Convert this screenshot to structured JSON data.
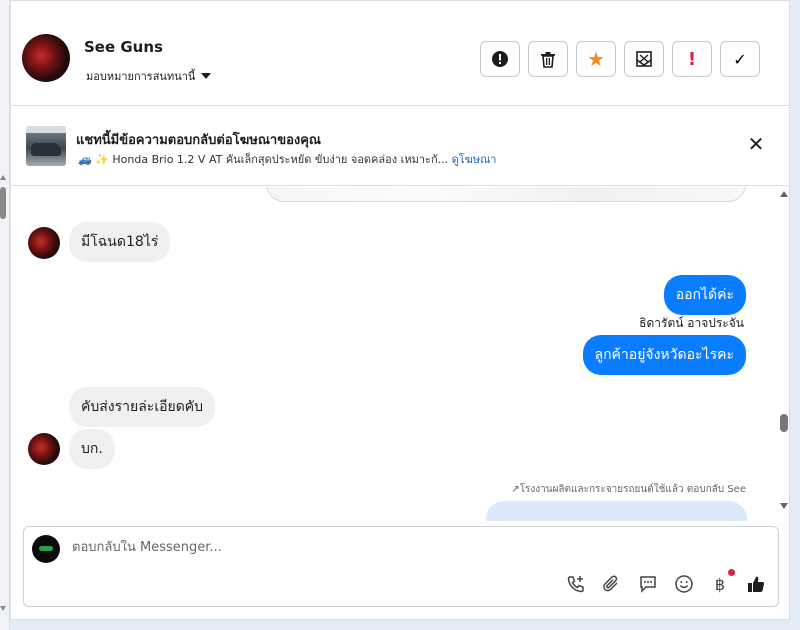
{
  "contact": {
    "name": "See Guns",
    "assign_label": "มอบหมายการสนทนานี้"
  },
  "actions": [
    {
      "name": "report-button",
      "glyph": "!"
    },
    {
      "name": "delete-button",
      "glyph": "🗑"
    },
    {
      "name": "star-button",
      "glyph": "★"
    },
    {
      "name": "mark-unread-button",
      "glyph": "✉"
    },
    {
      "name": "spam-button",
      "glyph": "!"
    },
    {
      "name": "done-button",
      "glyph": "✓"
    }
  ],
  "ad_banner": {
    "title": "แชทนี้มีข้อความตอบกลับต่อโฆษณาของคุณ",
    "subtitle": "🚙 ✨ Honda Brio 1.2 V AT คันเล็กสุดประหยัด ขับง่าย จอดคล่อง เหมาะกั...",
    "link_label": "ดูโฆษณา",
    "close_glyph": "✕"
  },
  "messages": [
    {
      "id": "m1",
      "direction": "in",
      "text": "มีโฉนด18ไร่"
    },
    {
      "id": "m2",
      "direction": "out",
      "text": "ออกได้ค่ะ"
    },
    {
      "id": "m3",
      "direction": "out",
      "text": "ลูกค้าอยู่จังหวัดอะไรคะ"
    },
    {
      "id": "m4",
      "direction": "in",
      "text": "คับส่งรายล่ะเอียดคับ"
    },
    {
      "id": "m5",
      "direction": "in",
      "text": "บก."
    }
  ],
  "sender_name": "ธิดารัตน์ อาจประจัน",
  "reply_note": "↗โรงงานผลิตและกระจายรถยนต์ใช้แล้ว ตอบกลับ See",
  "composer": {
    "placeholder": "ตอบกลับใน Messenger..."
  },
  "composer_tools": [
    {
      "name": "call-icon"
    },
    {
      "name": "attachment-icon"
    },
    {
      "name": "saved-replies-icon"
    },
    {
      "name": "emoji-icon"
    },
    {
      "name": "payment-icon",
      "glyph": "฿",
      "badge": true
    },
    {
      "name": "like-icon"
    }
  ]
}
